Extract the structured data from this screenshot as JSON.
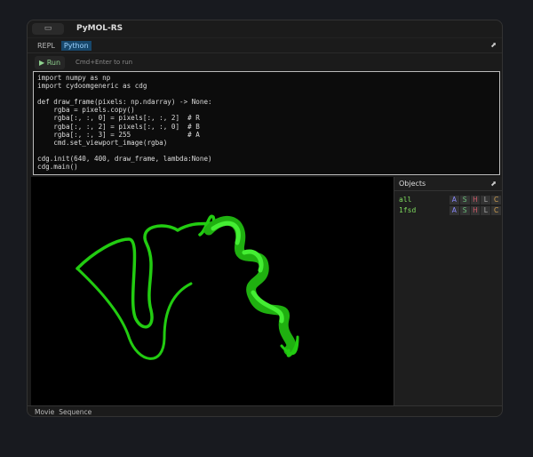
{
  "window": {
    "title": "PyMOL-RS",
    "title_button_icon": "monitor-icon"
  },
  "tabs": [
    {
      "label": "REPL"
    },
    {
      "label": "Python",
      "active": true
    }
  ],
  "run": {
    "label": "Run",
    "hint": "Cmd+Enter to run"
  },
  "editor": {
    "lines": [
      "import numpy as np",
      "import cydoomgeneric as cdg",
      "",
      "def draw_frame(pixels: np.ndarray) -> None:",
      "    rgba = pixels.copy()",
      "    rgba[:, :, 0] = pixels[:, :, 2]  # R",
      "    rgba[:, :, 2] = pixels[:, :, 0]  # B",
      "    rgba[:, :, 3] = 255              # A",
      "    cmd.set_viewport_image(rgba)",
      "",
      "cdg.init(640, 400, draw_frame, lambda:None)",
      "cdg.main()"
    ]
  },
  "objects": {
    "title": "Objects",
    "items": [
      {
        "name": "all",
        "buttons": [
          "A",
          "S",
          "H",
          "L",
          "C"
        ]
      },
      {
        "name": "1fsd",
        "buttons": [
          "A",
          "S",
          "H",
          "L",
          "C"
        ]
      }
    ]
  },
  "bottom": {
    "items": [
      "Movie",
      "Sequence"
    ]
  },
  "colors": {
    "protein": "#22cc11",
    "accent": "#17476b"
  }
}
